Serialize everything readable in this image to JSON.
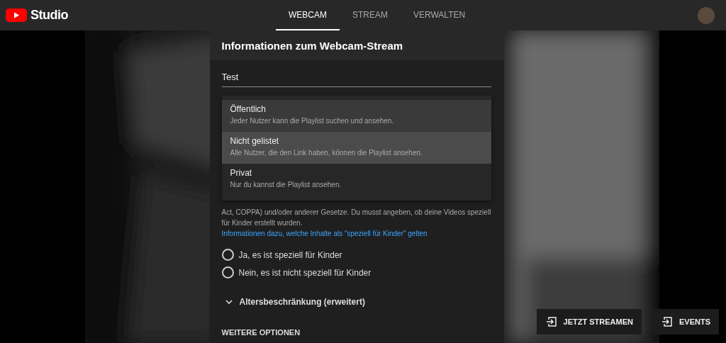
{
  "header": {
    "logo_text": "Studio",
    "tabs": [
      {
        "label": "WEBCAM",
        "selected": true
      },
      {
        "label": "STREAM",
        "selected": false
      },
      {
        "label": "VERWALTEN",
        "selected": false
      }
    ]
  },
  "dialog": {
    "title": "Informationen zum Webcam-Stream",
    "title_field": {
      "value": "Test"
    },
    "visibility_menu": [
      {
        "label": "Öffentlich",
        "description": "Jeder Nutzer kann die Playlist suchen und ansehen.",
        "selected": false,
        "hovered": true
      },
      {
        "label": "Nicht gelistet",
        "description": "Alle Nutzer, die den Link haben, können die Playlist ansehen.",
        "selected": true,
        "hovered": false
      },
      {
        "label": "Privat",
        "description": "Nur du kannst die Playlist ansehen.",
        "selected": false,
        "hovered": false
      }
    ],
    "coppa_text": "Act, COPPA) und/oder anderer Gesetze. Du musst angeben, ob deine Videos speziell für Kinder erstellt wurden.",
    "coppa_link": "Informationen dazu, welche Inhalte als \"speziell für Kinder\" gelten",
    "radios": [
      {
        "label": "Ja, es ist speziell für Kinder",
        "checked": false
      },
      {
        "label": "Nein, es ist nicht speziell für Kinder",
        "checked": false
      }
    ],
    "age_restriction": {
      "label": "Altersbeschränkung (erweitert)",
      "expanded": false
    },
    "more_options": "WEITERE OPTIONEN"
  },
  "actions": [
    {
      "label": "JETZT STREAMEN"
    },
    {
      "label": "EVENTS"
    }
  ]
}
